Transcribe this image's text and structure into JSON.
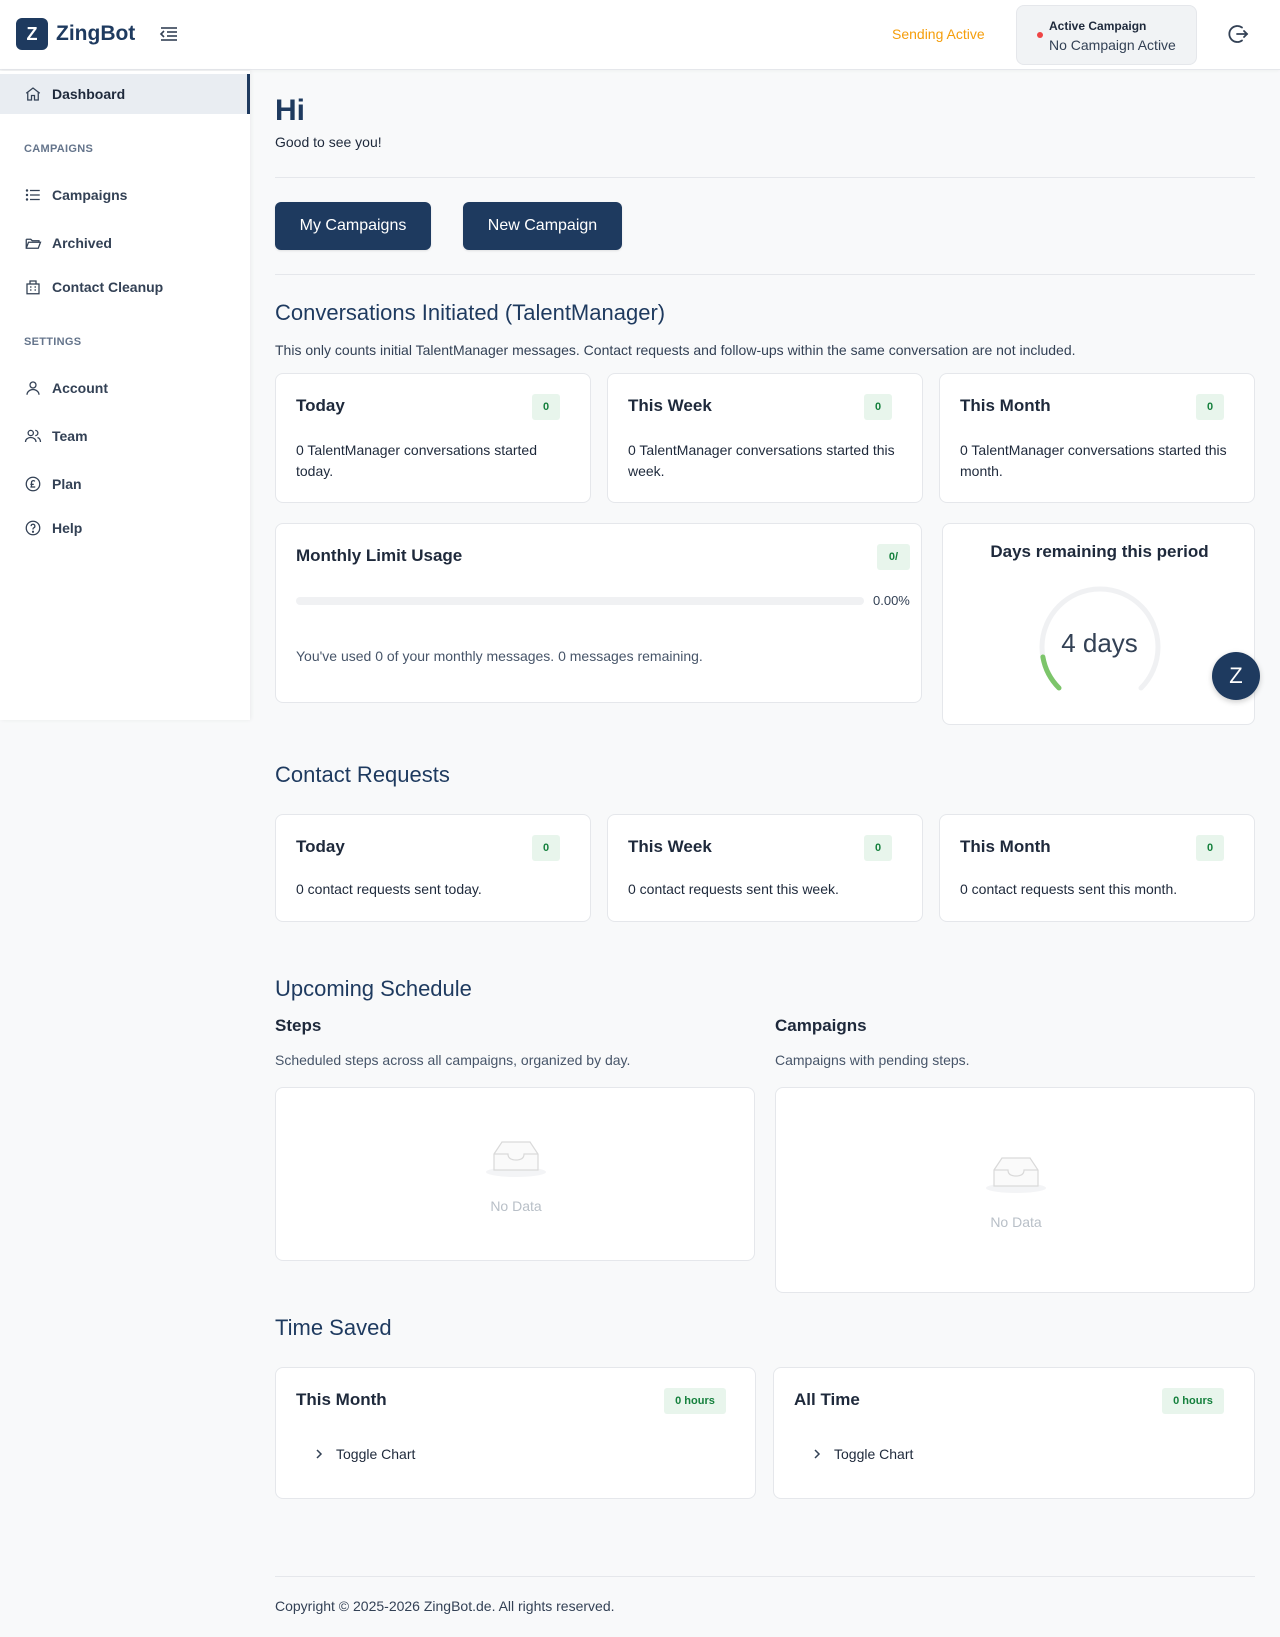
{
  "app": {
    "name": "ZingBot",
    "logo_letter": "Z"
  },
  "header": {
    "sending_status": "Sending Active",
    "active_campaign_label": "Active Campaign",
    "active_campaign_value": "No Campaign Active"
  },
  "sidebar": {
    "dashboard": "Dashboard",
    "campaigns_section": "CAMPAIGNS",
    "campaigns": "Campaigns",
    "archived": "Archived",
    "contact_cleanup": "Contact Cleanup",
    "settings_section": "SETTINGS",
    "account": "Account",
    "team": "Team",
    "plan": "Plan",
    "help": "Help"
  },
  "greeting": {
    "title": "Hi",
    "subtitle": "Good to see you!"
  },
  "actions": {
    "my_campaigns": "My Campaigns",
    "new_campaign": "New Campaign"
  },
  "conversations": {
    "title": "Conversations Initiated (TalentManager)",
    "description": "This only counts initial TalentManager messages. Contact requests and follow-ups within the same conversation are not included.",
    "cards": [
      {
        "title": "Today",
        "badge": "0",
        "text": "0 TalentManager conversations started today."
      },
      {
        "title": "This Week",
        "badge": "0",
        "text": "0 TalentManager conversations started this week."
      },
      {
        "title": "This Month",
        "badge": "0",
        "text": "0 TalentManager conversations started this month."
      }
    ]
  },
  "monthly_limit": {
    "title": "Monthly Limit Usage",
    "badge": "0/",
    "percent_label": "0.00%",
    "percent": 0,
    "text": "You've used 0 of your monthly messages. 0 messages remaining."
  },
  "days_remaining": {
    "title": "Days remaining this period",
    "value": "4 days",
    "fraction": 0.13,
    "color": "#7cc56a"
  },
  "contact_requests": {
    "title": "Contact Requests",
    "cards": [
      {
        "title": "Today",
        "badge": "0",
        "text": "0 contact requests sent today."
      },
      {
        "title": "This Week",
        "badge": "0",
        "text": "0 contact requests sent this week."
      },
      {
        "title": "This Month",
        "badge": "0",
        "text": "0 contact requests sent this month."
      }
    ]
  },
  "schedule": {
    "title": "Upcoming Schedule",
    "steps_title": "Steps",
    "steps_desc": "Scheduled steps across all campaigns, organized by day.",
    "steps_empty": "No Data",
    "campaigns_title": "Campaigns",
    "campaigns_desc": "Campaigns with pending steps.",
    "campaigns_empty": "No Data"
  },
  "time_saved": {
    "title": "Time Saved",
    "cards": [
      {
        "title": "This Month",
        "badge": "0 hours",
        "toggle": "Toggle Chart"
      },
      {
        "title": "All Time",
        "badge": "0 hours",
        "toggle": "Toggle Chart"
      }
    ]
  },
  "fab_letter": "Z",
  "footer": "Copyright © 2025-2026 ZingBot.de. All rights reserved.",
  "colors": {
    "brand": "#1e3a5f",
    "sending": "#f59e0b",
    "badge_bg": "#e8f5ec",
    "badge_text": "#15803d",
    "status_dot": "#ef4444"
  }
}
